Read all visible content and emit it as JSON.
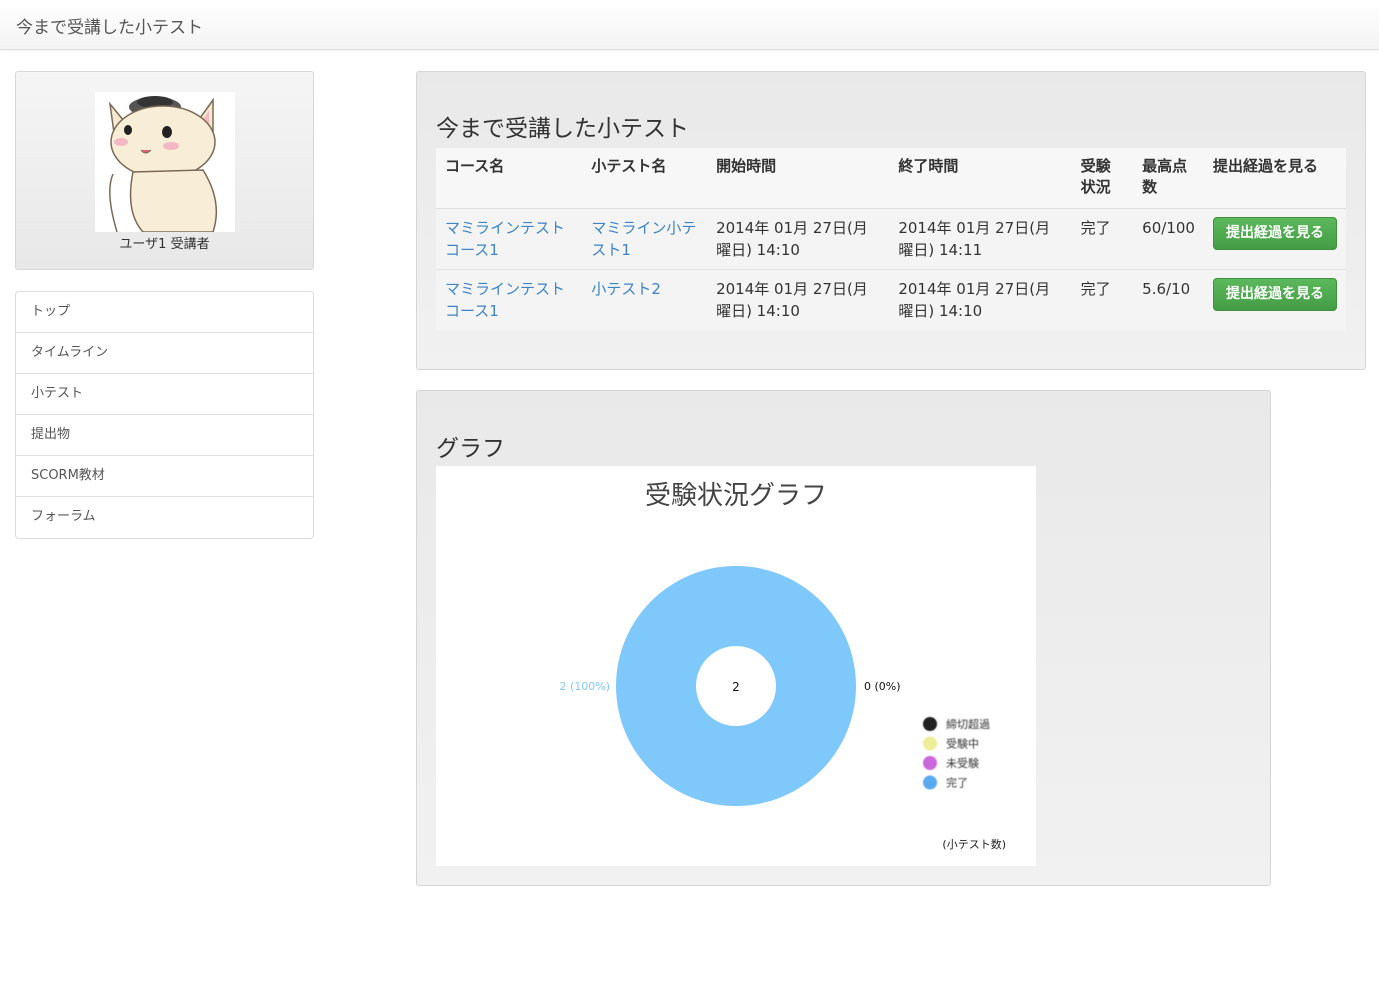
{
  "navbar": {
    "title": "今まで受講した小テスト"
  },
  "profile": {
    "user_label": "ユーザ1 受講者"
  },
  "sidebar": {
    "items": [
      {
        "label": "トップ"
      },
      {
        "label": "タイムライン"
      },
      {
        "label": "小テスト"
      },
      {
        "label": "提出物"
      },
      {
        "label": "SCORM教材"
      },
      {
        "label": "フォーラム"
      }
    ]
  },
  "tests_panel": {
    "title": "今まで受講した小テスト",
    "headers": {
      "course": "コース名",
      "quiz": "小テスト名",
      "start": "開始時間",
      "end": "終了時間",
      "status": "受験状況",
      "score": "最高点数",
      "action": "提出経過を見る"
    },
    "rows": [
      {
        "course": "マミラインテストコース1",
        "quiz": "マミライン小テスト1",
        "start": "2014年 01月 27日(月曜日) 14:10",
        "end": "2014年 01月 27日(月曜日) 14:11",
        "status": "完了",
        "score": "60/100",
        "button": "提出経過を見る"
      },
      {
        "course": "マミラインテストコース1",
        "quiz": "小テスト2",
        "start": "2014年 01月 27日(月曜日) 14:10",
        "end": "2014年 01月 27日(月曜日) 14:10",
        "status": "完了",
        "score": "5.6/10",
        "button": "提出経過を見る"
      }
    ]
  },
  "graph_panel": {
    "title": "グラフ"
  },
  "chart_data": {
    "type": "pie",
    "title": "受験状況グラフ",
    "center_label": "2",
    "unit_label": "(小テスト数)",
    "categories": [
      "締切超過",
      "受験中",
      "未受験",
      "完了"
    ],
    "values": [
      0,
      0,
      0,
      2
    ],
    "colors": [
      "#222222",
      "#eeee99",
      "#cc66dd",
      "#5aaaf0"
    ],
    "ring_color": "#7fc8fc",
    "slice_labels": {
      "left": "2 (100%)",
      "right": "0 (0%)"
    },
    "legend_position": "bottom-right"
  }
}
